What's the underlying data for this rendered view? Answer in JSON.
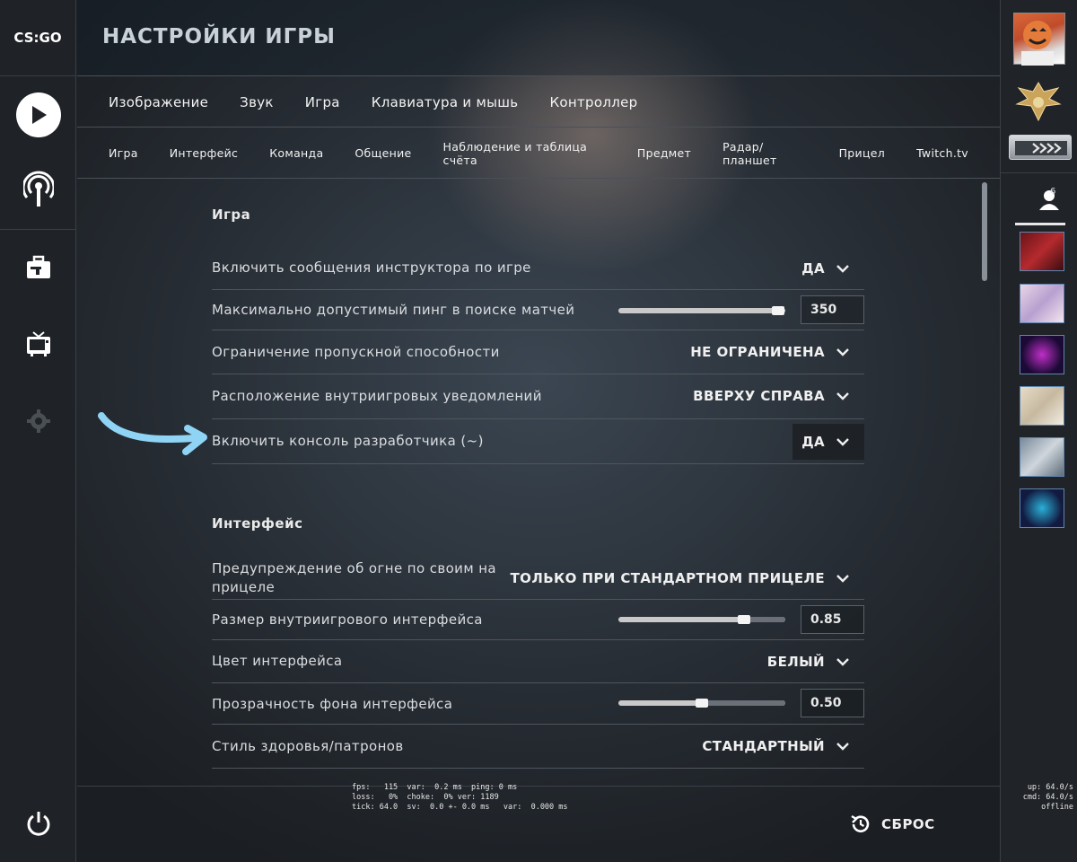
{
  "logo": "CS:GO",
  "header": {
    "title": "НАСТРОЙКИ ИГРЫ"
  },
  "tabs": [
    {
      "label": "Изображение"
    },
    {
      "label": "Звук"
    },
    {
      "label": "Игра"
    },
    {
      "label": "Клавиатура и мышь"
    },
    {
      "label": "Контроллер"
    }
  ],
  "subtabs": [
    {
      "label": "Игра"
    },
    {
      "label": "Интерфейс"
    },
    {
      "label": "Команда"
    },
    {
      "label": "Общение"
    },
    {
      "label": "Наблюдение и таблица счёта"
    },
    {
      "label": "Предмет"
    },
    {
      "label": "Радар/планшет"
    },
    {
      "label": "Прицел"
    },
    {
      "label": "Twitch.tv"
    }
  ],
  "section_game": {
    "title": "Игра",
    "rows": [
      {
        "label": "Включить сообщения инструктора по игре",
        "value": "ДА"
      },
      {
        "label": "Максимально допустимый пинг в поиске матчей",
        "value": "350",
        "slider_fraction": 0.97
      },
      {
        "label": "Ограничение пропускной способности",
        "value": "НЕ ОГРАНИЧЕНА"
      },
      {
        "label": "Расположение внутриигровых уведомлений",
        "value": "ВВЕРХУ СПРАВА"
      },
      {
        "label": "Включить консоль разработчика (~)",
        "value": "ДА"
      }
    ]
  },
  "section_interface": {
    "title": "Интерфейс",
    "rows": [
      {
        "label": "Предупреждение об огне по своим на прицеле",
        "value": "ТОЛЬКО ПРИ СТАНДАРТНОМ ПРИЦЕЛЕ"
      },
      {
        "label": "Размер внутриигрового интерфейса",
        "value": "0.85",
        "slider_fraction": 0.75
      },
      {
        "label": "Цвет интерфейса",
        "value": "БЕЛЫЙ"
      },
      {
        "label": "Прозрачность фона интерфейса",
        "value": "0.50",
        "slider_fraction": 0.5
      },
      {
        "label": "Стиль здоровья/патронов",
        "value": "СТАНДАРТНЫЙ"
      }
    ]
  },
  "netgraph": {
    "line1": "fps:   115  var:  0.2 ms  ping: 0 ms",
    "line2": "loss:   0%  choke:  0% ver: 1189",
    "line3": "tick: 64.0  sv:  0.0 +- 0.0 ms   var:  0.000 ms"
  },
  "net_right": {
    "line1": "up: 64.0/s",
    "line2": "cmd: 64.0/s",
    "line3": "offline"
  },
  "reset_label": "СБРОС",
  "friends": {
    "count": "6"
  },
  "colors": {
    "accent_arrow": "#8fd3f5",
    "panel": "#1f2226"
  }
}
